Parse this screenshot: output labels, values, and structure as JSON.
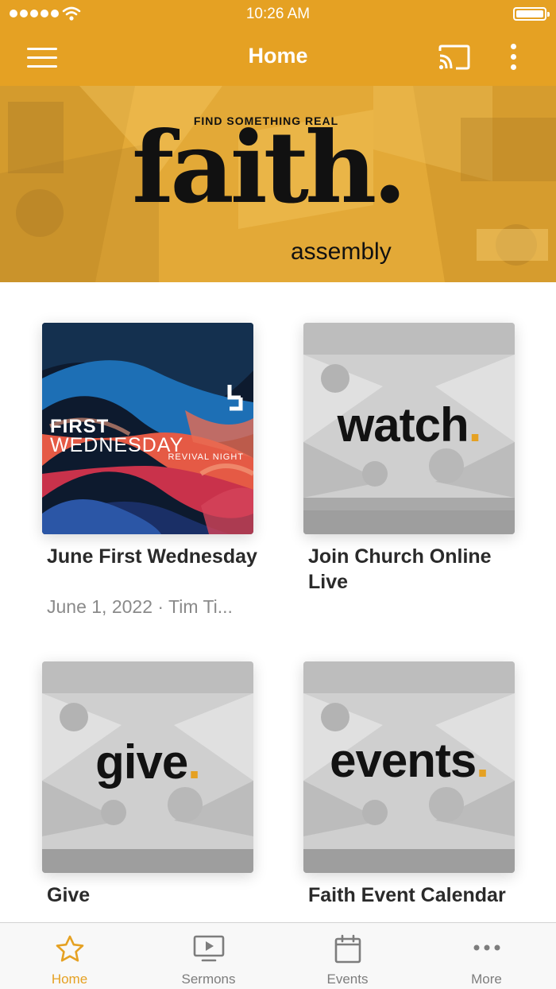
{
  "status_bar": {
    "time": "10:26 AM"
  },
  "nav": {
    "title": "Home"
  },
  "banner": {
    "tagline_prefix": "FIND SOMETHING ",
    "tagline_emphasis": "REAL",
    "brand_word": "faith.",
    "brand_sub": "assembly"
  },
  "cards": [
    {
      "title": "June First Wednesday",
      "meta": "June 1, 2022 · Tim Ti...",
      "art": {
        "line1": "FIRST",
        "line2": "WEDNESDAY",
        "line3": "REVIVAL NIGHT"
      }
    },
    {
      "title": "Join Church Online Live",
      "art_word": "watch"
    },
    {
      "title": "Give",
      "art_word": "give"
    },
    {
      "title": "Faith Event Calendar",
      "art_word": "events"
    }
  ],
  "tabs": [
    {
      "label": "Home",
      "icon": "star-icon",
      "active": true
    },
    {
      "label": "Sermons",
      "icon": "tv-play-icon",
      "active": false
    },
    {
      "label": "Events",
      "icon": "calendar-icon",
      "active": false
    },
    {
      "label": "More",
      "icon": "more-dots-icon",
      "active": false
    }
  ],
  "colors": {
    "accent": "#e5a123",
    "tab_inactive": "#7d7d7d",
    "title_text": "#2a2a2a",
    "meta_text": "#8a8a8a"
  }
}
